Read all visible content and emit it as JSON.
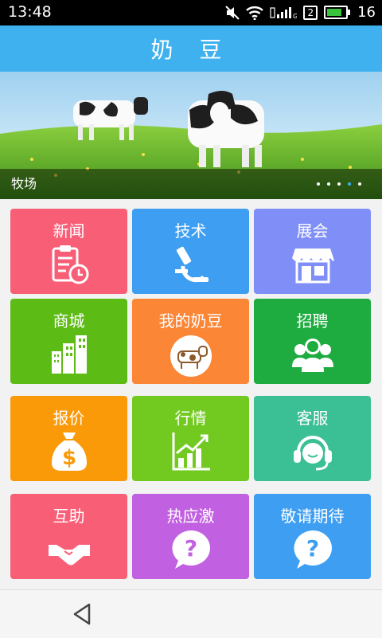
{
  "status_bar": {
    "time": "13:48",
    "sim_label": "2",
    "battery_level": "16"
  },
  "header": {
    "title": "奶 豆"
  },
  "banner": {
    "caption": "牧场",
    "page_count": 5,
    "active_page": 4
  },
  "tiles": [
    {
      "label": "新闻",
      "color": "#f95e77",
      "icon": "clipboard-clock-icon"
    },
    {
      "label": "技术",
      "color": "#3d9ef2",
      "icon": "microscope-icon"
    },
    {
      "label": "展会",
      "color": "#7f8ff7",
      "icon": "storefront-icon"
    },
    {
      "label": "商城",
      "color": "#5dbb16",
      "icon": "city-buildings-icon"
    },
    {
      "label": "我的奶豆",
      "color": "#fb8636",
      "icon": "cow-icon"
    },
    {
      "label": "招聘",
      "color": "#1eab3f",
      "icon": "people-icon"
    },
    {
      "label": "报价",
      "color": "#fb9a08",
      "icon": "money-bag-icon"
    },
    {
      "label": "行情",
      "color": "#72c920",
      "icon": "chart-up-icon"
    },
    {
      "label": "客服",
      "color": "#3bbf94",
      "icon": "headset-icon"
    },
    {
      "label": "互助",
      "color": "#f95e77",
      "icon": "handshake-icon"
    },
    {
      "label": "热应激",
      "color": "#c160e0",
      "icon": "question-bubble-icon"
    },
    {
      "label": "敬请期待",
      "color": "#3d9ef2",
      "icon": "question-bubble-icon"
    }
  ]
}
